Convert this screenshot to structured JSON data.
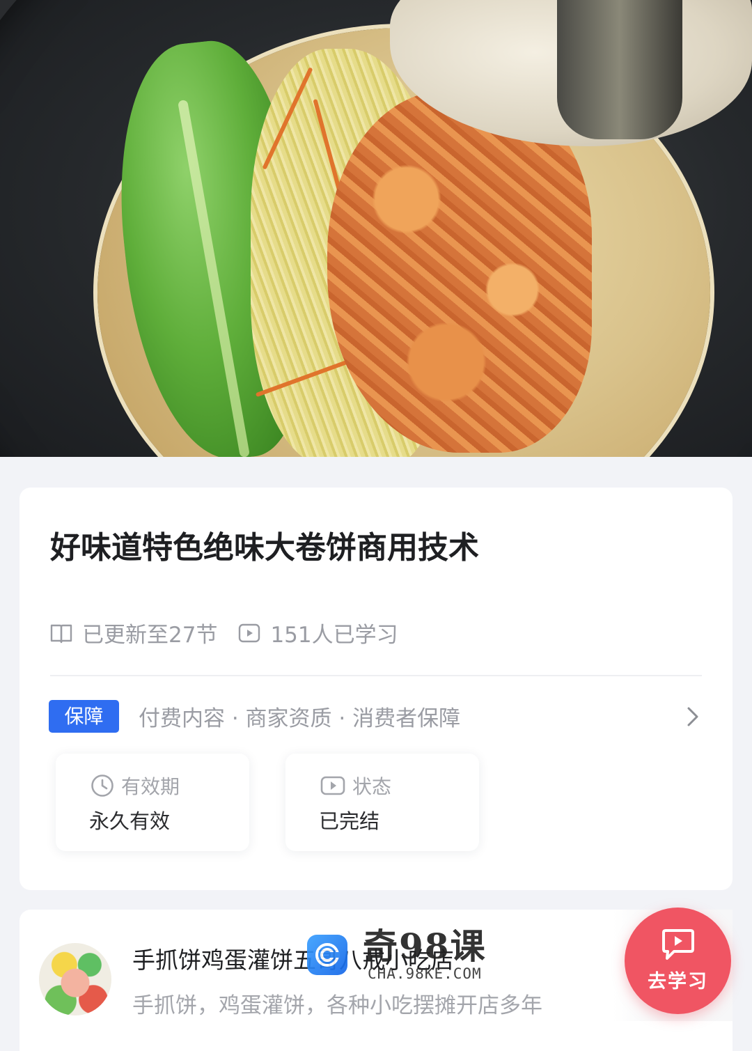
{
  "course": {
    "title": "好味道特色绝味大卷饼商用技术",
    "updated": "已更新至27节",
    "learners": "151人已学习"
  },
  "guarantee": {
    "badge": "保障",
    "items": "付费内容 · 商家资质 · 消费者保障"
  },
  "info": {
    "validity_label": "有效期",
    "validity_value": "永久有效",
    "status_label": "状态",
    "status_value": "已完结"
  },
  "shop": {
    "name": "手抓饼鸡蛋灌饼五哥八戒小吃店",
    "description": "手抓饼，鸡蛋灌饼，各种小吃摆摊开店多年"
  },
  "watermark": {
    "title": "奇98课",
    "subtitle": "CHA.98KE.COM"
  },
  "cta": {
    "label": "去学习"
  },
  "colors": {
    "accent_blue": "#2f6df1",
    "cta_red": "#f05563",
    "muted_text": "#9a9ca3",
    "page_background": "#f2f3f7"
  },
  "icons": [
    "book-icon",
    "video-icon",
    "chevron-right-icon",
    "clock-icon",
    "play-icon",
    "chat-tv-icon"
  ]
}
